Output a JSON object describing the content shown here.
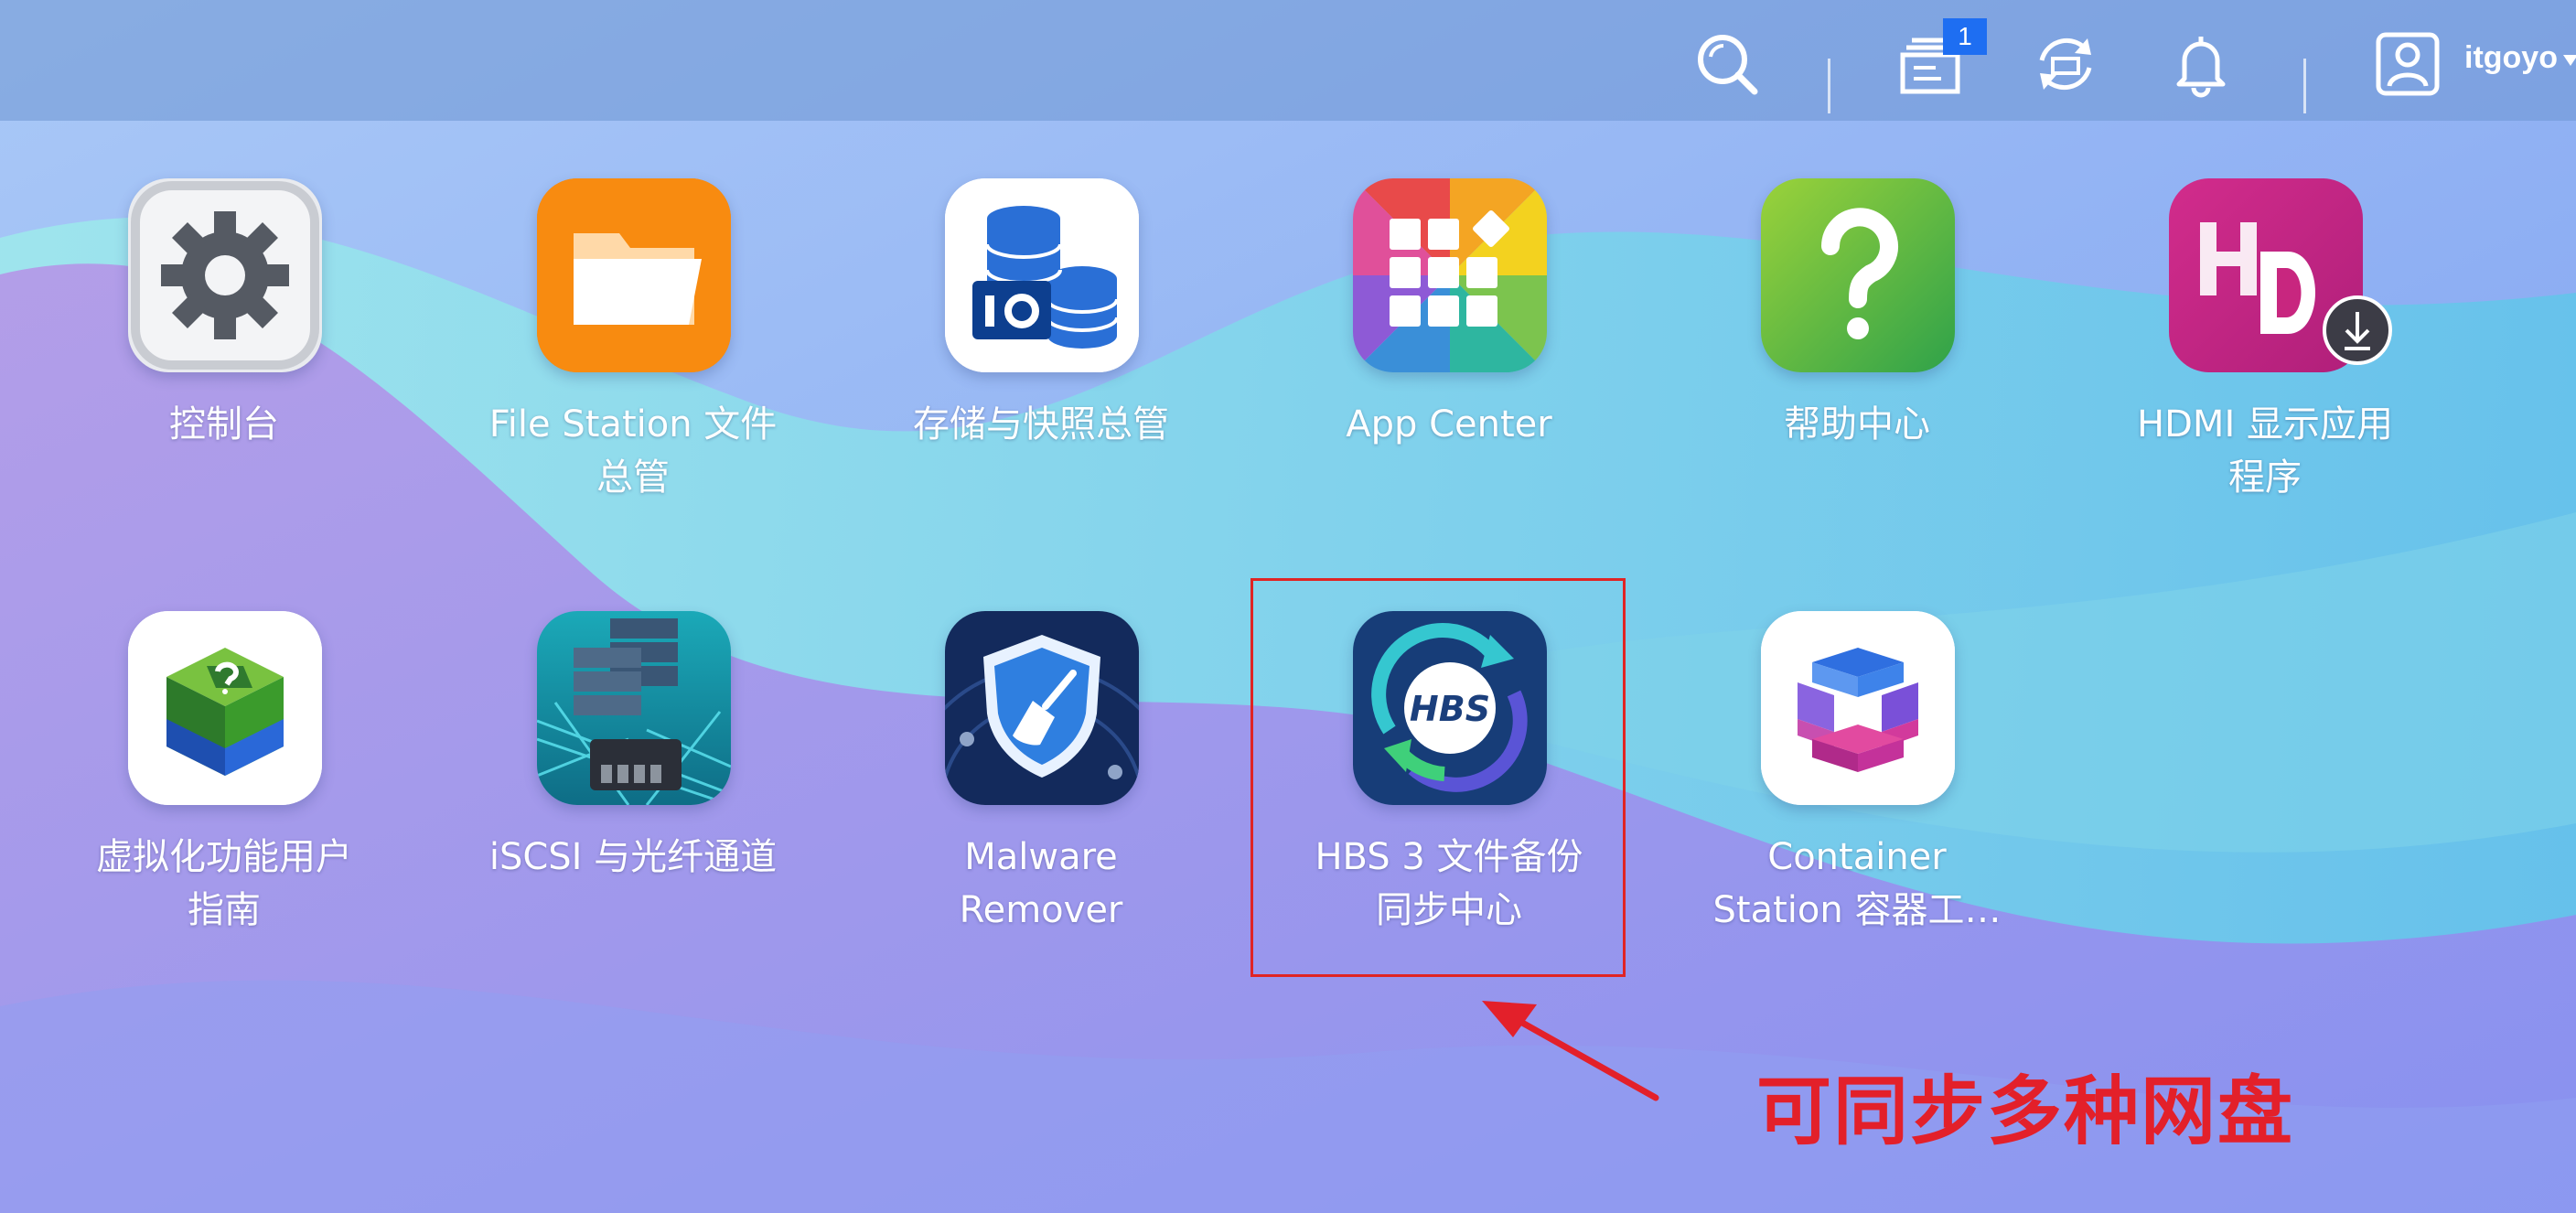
{
  "topbar": {
    "notification_badge": "1",
    "username": "itgoyo",
    "icons": [
      "search-icon",
      "task-stack-icon",
      "sync-icon",
      "bell-icon",
      "user-icon",
      "caret-down-icon"
    ]
  },
  "apps": [
    {
      "label": "控制台",
      "icon": "gear-icon"
    },
    {
      "label": "File Station 文件\n总管",
      "icon": "folder-icon"
    },
    {
      "label": "存储与快照总管",
      "icon": "storage-icon"
    },
    {
      "label": "App Center",
      "icon": "app-grid-icon"
    },
    {
      "label": "帮助中心",
      "icon": "question-icon"
    },
    {
      "label": "HDMI 显示应用\n程序",
      "icon": "hd-icon"
    },
    {
      "label": "虚拟化功能用户\n指南",
      "icon": "virtual-cube-icon"
    },
    {
      "label": "iSCSI 与光纤通道",
      "icon": "iscsi-server-icon"
    },
    {
      "label": "Malware\nRemover",
      "icon": "shield-broom-icon"
    },
    {
      "label": "HBS 3 文件备份\n同步中心",
      "icon": "hbs-sync-icon"
    },
    {
      "label": "Container\nStation 容器工…",
      "icon": "container-icon"
    }
  ],
  "annotation": {
    "text": "可同步多种网盘",
    "color": "#e3202a"
  },
  "colors": {
    "accent_badge": "#1e6ef2",
    "highlight": "#e02424"
  }
}
